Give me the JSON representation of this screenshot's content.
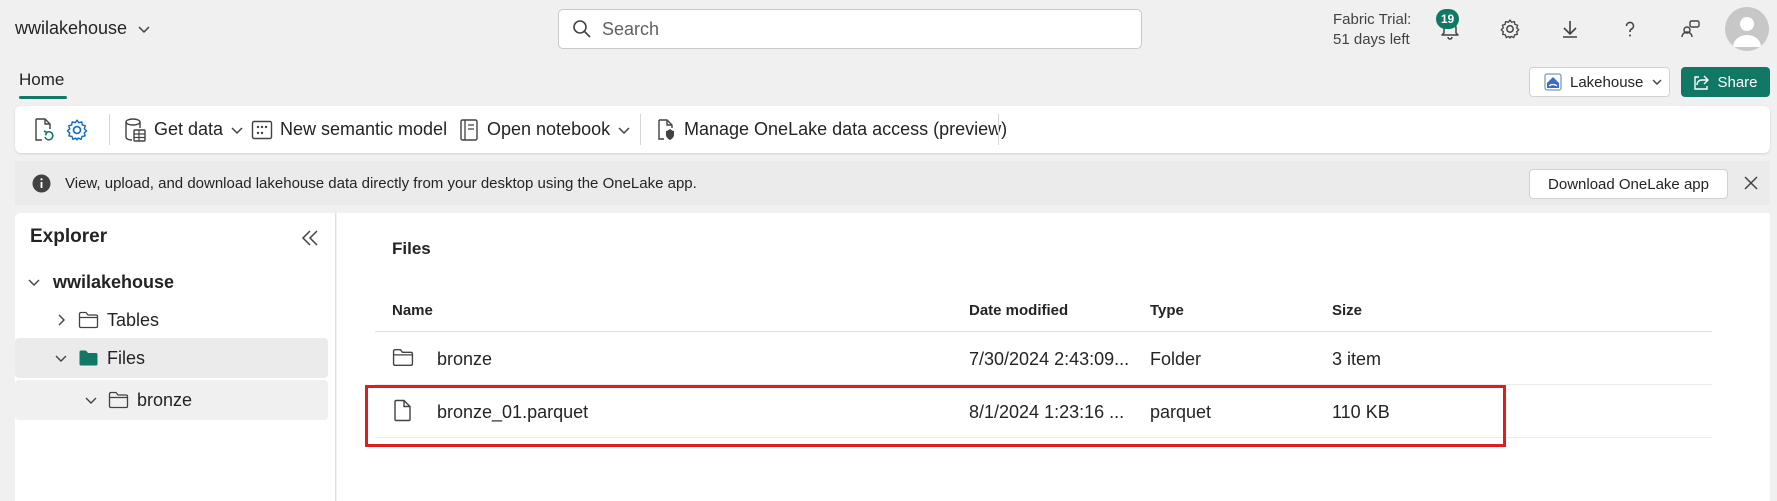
{
  "header": {
    "workspace_name": "wwilakehouse",
    "search_placeholder": "Search",
    "trial_line1": "Fabric Trial:",
    "trial_line2": "51 days left",
    "notification_count": "19"
  },
  "tabs": {
    "home_label": "Home"
  },
  "lakehouse_dropdown": {
    "label": "Lakehouse"
  },
  "share_button": {
    "label": "Share"
  },
  "ribbon": {
    "get_data": "Get data",
    "new_semantic_model": "New semantic model",
    "open_notebook": "Open notebook",
    "manage_access": "Manage OneLake data access (preview)"
  },
  "banner": {
    "text": "View, upload, and download lakehouse data directly from your desktop using the OneLake app.",
    "download_button": "Download OneLake app"
  },
  "explorer": {
    "title": "Explorer",
    "root": "wwilakehouse",
    "items": [
      {
        "label": "Tables"
      },
      {
        "label": "Files"
      },
      {
        "label": "bronze"
      }
    ]
  },
  "files_view": {
    "title": "Files",
    "columns": {
      "name": "Name",
      "date_modified": "Date modified",
      "type": "Type",
      "size": "Size"
    },
    "rows": [
      {
        "name": "bronze",
        "date_modified": "7/30/2024 2:43:09...",
        "type": "Folder",
        "size": "3 item",
        "icon": "folder-icon"
      },
      {
        "name": "bronze_01.parquet",
        "date_modified": "8/1/2024 1:23:16 ...",
        "type": "parquet",
        "size": "110 KB",
        "icon": "file-icon"
      }
    ]
  },
  "colors": {
    "accent": "#117865",
    "highlight": "#e11c1c"
  }
}
